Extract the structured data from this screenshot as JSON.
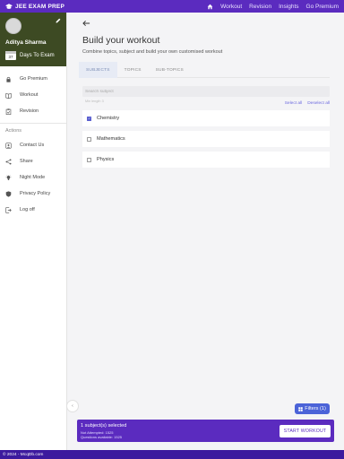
{
  "app": {
    "brand": "JEE EXAM PREP"
  },
  "topnav": {
    "items": [
      "Workout",
      "Revision",
      "Insights",
      "Go Premium"
    ]
  },
  "profile": {
    "name": "Aditya Sharma",
    "days_number": "37",
    "days_label": "Days To Exam"
  },
  "sidebar": {
    "menu": [
      {
        "label": "Go Premium",
        "icon": "lock-icon"
      },
      {
        "label": "Workout",
        "icon": "book-icon"
      },
      {
        "label": "Revision",
        "icon": "clipboard-icon"
      }
    ],
    "actions_title": "Actions",
    "actions": [
      {
        "label": "Contact Us",
        "icon": "contact-icon"
      },
      {
        "label": "Share",
        "icon": "share-icon"
      },
      {
        "label": "Night Mode",
        "icon": "lightbulb-icon"
      },
      {
        "label": "Privacy Policy",
        "icon": "shield-icon"
      },
      {
        "label": "Log off",
        "icon": "logout-icon"
      }
    ]
  },
  "main": {
    "title": "Build your workout",
    "subtitle": "Combine topics, subject and build your own customised workout",
    "tabs": [
      "SUBJECTS",
      "TOPICS",
      "SUB-TOPICS"
    ],
    "search_placeholder": "Search subject",
    "search_hint": "Min length 3",
    "select_all": "Select all",
    "deselect_all": "Deselect all",
    "subjects": [
      {
        "label": "Chemistry",
        "checked": true
      },
      {
        "label": "Mathematics",
        "checked": false
      },
      {
        "label": "Physics",
        "checked": false
      }
    ]
  },
  "filters": {
    "label": "Filters (1)"
  },
  "bottom": {
    "selected": "1 subject(s) selected",
    "not_attempted": "Not Attempted: 1525",
    "questions_available": "Questions available: 1525",
    "start_button": "START WORKOUT"
  },
  "footer": {
    "text": "© 2024 - McqDb.com"
  },
  "colors": {
    "primary": "#5b2bbf",
    "footer": "#3c1a9e",
    "profile_bg": "#3d4a23",
    "accent": "#5a5fcf",
    "filters": "#4b63d8"
  }
}
